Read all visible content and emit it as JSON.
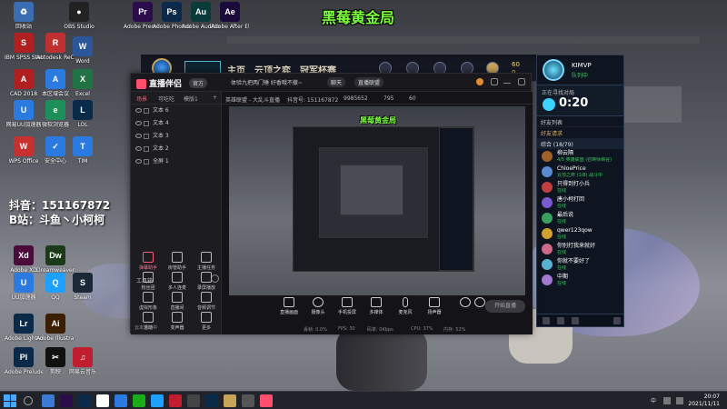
{
  "overlay": {
    "top_title": "黑莓黄金局",
    "douyin_line1": "抖音：151167872",
    "douyin_line2": "B站：斗鱼丶小柯柯",
    "preview_title": "黑莓黄金局"
  },
  "desktop_icons": [
    {
      "name": "recycle-bin",
      "label": "回收站",
      "color": "#3b6db3",
      "glyph": "♻"
    },
    {
      "name": "pr-2020",
      "label": "Adobe Premi...",
      "color": "#2a0d4a",
      "glyph": "Pr"
    },
    {
      "name": "adobe-photoshop",
      "label": "Adobe Photosho...",
      "color": "#0b2a4a",
      "glyph": "Ps"
    },
    {
      "name": "adobe-audition",
      "label": "Adobe Audition",
      "color": "#0b3a3a",
      "glyph": "Au"
    },
    {
      "name": "adobe-after-effects",
      "label": "Adobe After Effects",
      "color": "#1a0b3a",
      "glyph": "Ae"
    },
    {
      "name": "obs-studio",
      "label": "OBS Studio",
      "color": "#222",
      "glyph": "●"
    },
    {
      "name": "ibm-spss",
      "label": "IBM SPSS Statistics 21",
      "color": "#b02020",
      "glyph": "S"
    },
    {
      "name": "autodesk-recap",
      "label": "Autodesk ReCap",
      "color": "#c03030",
      "glyph": "R"
    },
    {
      "name": "cad-2018",
      "label": "CAD 2018",
      "color": "#b02020",
      "glyph": "A"
    },
    {
      "name": "local-cad",
      "label": "本区域会议",
      "color": "#2a7ae0",
      "glyph": "A"
    },
    {
      "name": "vpn",
      "label": "网易UU加速器",
      "color": "#2a7ae0",
      "glyph": "U"
    },
    {
      "name": "browser",
      "label": "微软浏览器",
      "color": "#1f8f5a",
      "glyph": "e"
    },
    {
      "name": "wps",
      "label": "WPS Office",
      "color": "#c83030",
      "glyph": "W"
    },
    {
      "name": "defender",
      "label": "安全中心",
      "color": "#2a7ae0",
      "glyph": "✓"
    },
    {
      "name": "adobe-xd",
      "label": "Adobe XD",
      "color": "#4a0a3a",
      "glyph": "Xd"
    },
    {
      "name": "dreamweaver",
      "label": "Dreamweaver",
      "color": "#1a3a1a",
      "glyph": "Dw"
    },
    {
      "name": "lightroom",
      "label": "Adobe Lightroom",
      "color": "#0b2a4a",
      "glyph": "Lr"
    },
    {
      "name": "illustrator",
      "label": "Adobe Illustrator",
      "color": "#3a2000",
      "glyph": "Ai"
    },
    {
      "name": "prelude",
      "label": "Adobe Prelude",
      "color": "#0b2a4a",
      "glyph": "Pl"
    },
    {
      "name": "capcut",
      "label": "剪映",
      "color": "#111",
      "glyph": "✂"
    },
    {
      "name": "netease-music",
      "label": "网易云音乐",
      "color": "#c01d2e",
      "glyph": "♫"
    },
    {
      "name": "qq",
      "label": "QQ",
      "color": "#1ea0ff",
      "glyph": "Q"
    },
    {
      "name": "steam",
      "label": "Steam",
      "color": "#1b2838",
      "glyph": "S"
    },
    {
      "name": "uu",
      "label": "UU加速器",
      "color": "#2a7ae0",
      "glyph": "U"
    },
    {
      "name": "word",
      "label": "Word",
      "color": "#2b579a",
      "glyph": "W"
    },
    {
      "name": "excel",
      "label": "Excel",
      "color": "#217346",
      "glyph": "X"
    },
    {
      "name": "lol",
      "label": "LOL",
      "color": "#0a2a4a",
      "glyph": "L"
    },
    {
      "name": "tim",
      "label": "TIM",
      "color": "#2a7ae0",
      "glyph": "T"
    }
  ],
  "client": {
    "nav": [
      "主页",
      "云顶之弈",
      "冠军杯赛"
    ],
    "coins1": "60",
    "coins2": "0",
    "username": "KIMVP",
    "status": "队列中",
    "queue_label": "正在寻找对局",
    "queue_time": "0:20",
    "friends_header": "好友列表",
    "friend_requests": "好友请求",
    "group_label": "综合 (18/79)",
    "friends": [
      {
        "name": "柳云隔",
        "status": "4/5 英雄联盟 (召唤师峡谷)",
        "color": "#a0602a"
      },
      {
        "name": "ChloePrice",
        "status": "云顶之弈 (1/8) 战斗中",
        "color": "#5a8ad0"
      },
      {
        "name": "只得到打小兵",
        "status": "在线",
        "color": "#c04040"
      },
      {
        "name": "唐小柯打回",
        "status": "在线",
        "color": "#7a5ad0"
      },
      {
        "name": "最后说",
        "status": "在线",
        "color": "#3aa060"
      },
      {
        "name": "qwer123qow",
        "status": "在线",
        "color": "#d0a030"
      },
      {
        "name": "你别打我来就好",
        "status": "在线",
        "color": "#d06a8a"
      },
      {
        "name": "你就不要好了",
        "status": "在线",
        "color": "#5ab0d0"
      },
      {
        "name": "中期",
        "status": "在线",
        "color": "#a07ad0"
      }
    ]
  },
  "stream": {
    "app_name": "直播伴侣",
    "free_badge": "官方",
    "room_title": "体验九把两门锤 好香哦不撤~",
    "tag_category": "聊天",
    "tag_game": "直播联盟",
    "info_items": [
      "英雄联盟 - 大乱斗直播",
      "抖音号: 151167872",
      "9985652",
      "795",
      "60"
    ],
    "tabs": [
      "场景",
      "可吃吃",
      "模版1"
    ],
    "scenes": [
      "文本 6",
      "文本 4",
      "文本 3",
      "文本 2",
      "全屏 1"
    ],
    "tools_label": "工具箱",
    "tools": [
      "弹幕助手",
      "房管助手",
      "主播任务",
      "粉丝团",
      "多人连麦",
      "录屏播放",
      "虚拟形象",
      "直播间",
      "音频调节",
      "活动",
      "变声器",
      "更多"
    ],
    "left_footer": "云本直播中",
    "controls": [
      "直播画面",
      "摄像头",
      "手机投屏",
      "多媒体",
      "麦克风",
      "扬声器"
    ],
    "go_live": "开始直播",
    "status_bar": [
      "丢帧: 0.0%",
      "FPS: 30",
      "码率: 0Kbps",
      "CPU: 37%",
      "内存: 52%"
    ]
  },
  "taskbar": {
    "time": "20:07",
    "date": "2021/11/11",
    "tray_lang": "中",
    "search_placeholder": ""
  }
}
